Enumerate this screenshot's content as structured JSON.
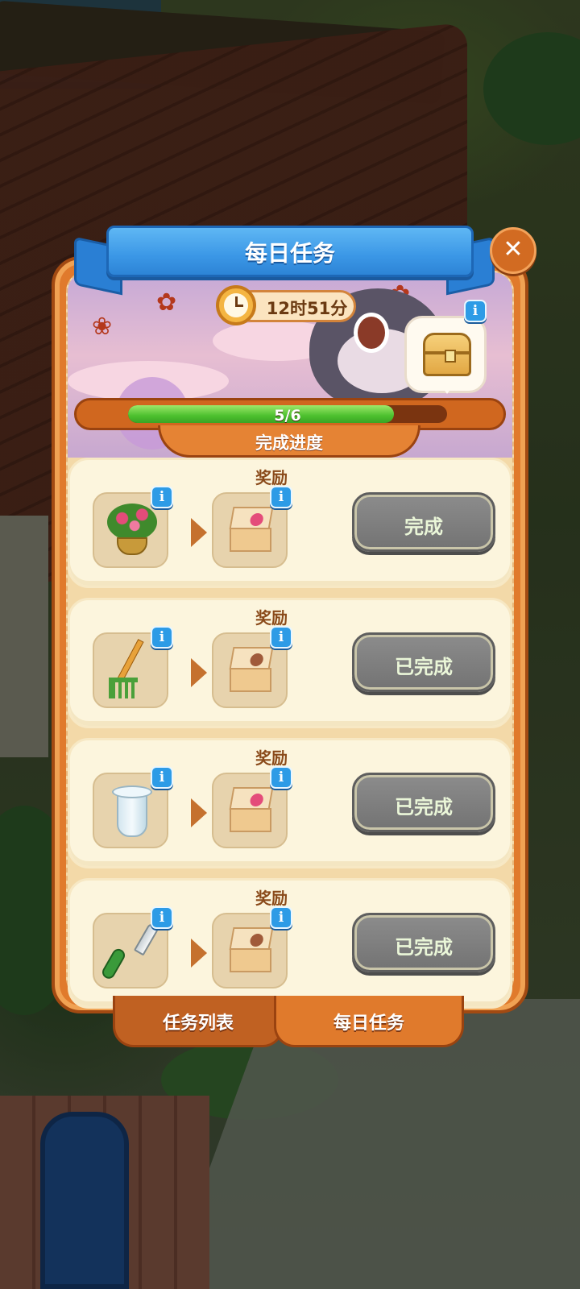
{
  "header": {
    "title": "每日任务",
    "close_icon": "close-icon"
  },
  "timer": {
    "icon": "clock-icon",
    "text": "12时51分"
  },
  "chest": {
    "icon": "treasure-chest-icon",
    "info_icon": "i"
  },
  "progress": {
    "text": "5/6",
    "completed": 5,
    "total": 6,
    "label": "完成进度"
  },
  "tasks": [
    {
      "title": "奖励",
      "item_icon": "flower-pot-icon",
      "reward_icon": "gift-box-icon",
      "status": "完成",
      "info": "i"
    },
    {
      "title": "奖励",
      "item_icon": "rake-icon",
      "reward_icon": "gift-box-icon",
      "status": "已完成",
      "info": "i"
    },
    {
      "title": "奖励",
      "item_icon": "vase-icon",
      "reward_icon": "gift-box-icon",
      "status": "已完成",
      "info": "i"
    },
    {
      "title": "奖励",
      "item_icon": "trowel-icon",
      "reward_icon": "gift-box-icon",
      "status": "已完成",
      "info": "i"
    }
  ],
  "tabs": [
    {
      "label": "任务列表",
      "active": false
    },
    {
      "label": "每日任务",
      "active": true
    }
  ],
  "colors": {
    "panel_orange": "#e07a2c",
    "ribbon_blue": "#3b97e6",
    "progress_green": "#4cc02e",
    "button_gray": "#7f7f7f",
    "card_cream": "#fcf5dd"
  }
}
